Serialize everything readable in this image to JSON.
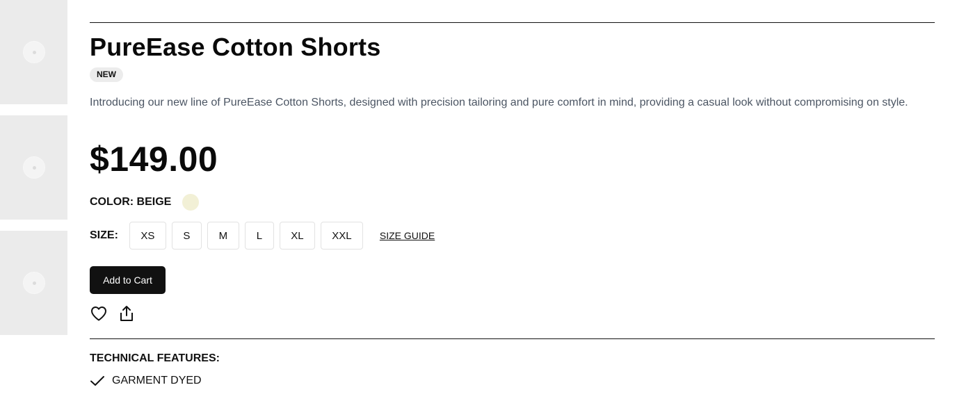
{
  "product": {
    "title": "PureEase Cotton Shorts",
    "badge": "NEW",
    "description": "Introducing our new line of PureEase Cotton Shorts, designed with precision tailoring and pure comfort in mind, providing a casual look without compromising on style.",
    "price": "$149.00"
  },
  "color": {
    "label": "COLOR: BEIGE",
    "swatch_hex": "#f2f0d6"
  },
  "size": {
    "label": "SIZE:",
    "options": [
      "XS",
      "S",
      "M",
      "L",
      "XL",
      "XXL"
    ],
    "guide_label": "SIZE GUIDE"
  },
  "actions": {
    "add_to_cart": "Add to Cart",
    "wishlist_icon": "heart-icon",
    "share_icon": "share-icon"
  },
  "technical": {
    "title": "TECHNICAL FEATURES:",
    "features": [
      "GARMENT DYED"
    ]
  },
  "gallery": {
    "thumbnail_icon": "image-placeholder-icon",
    "thumbnail_count": 3
  }
}
